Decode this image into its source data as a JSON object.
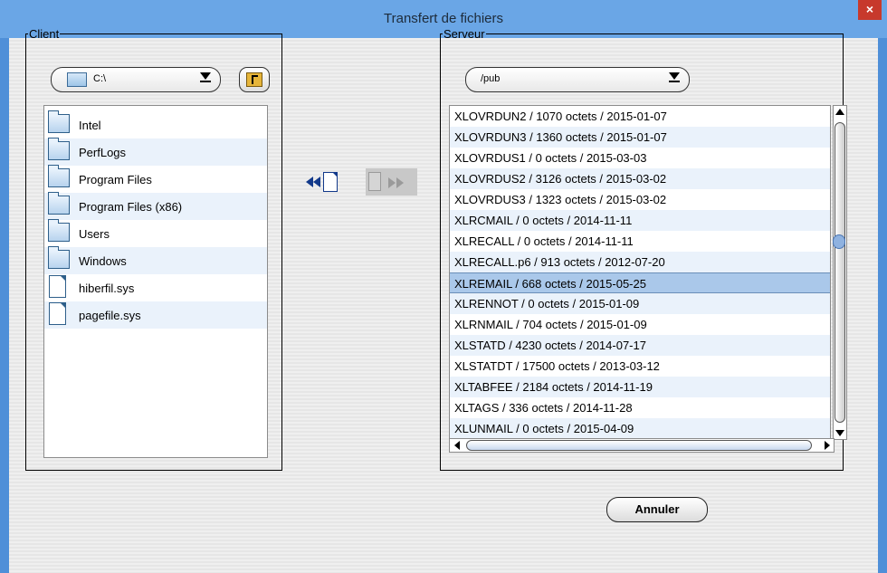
{
  "window": {
    "title": "Transfert de fichiers",
    "close_glyph": "×"
  },
  "client": {
    "legend": "Client",
    "path": "C:\\",
    "items": [
      {
        "name": "Intel",
        "icon": "folder-icon"
      },
      {
        "name": "PerfLogs",
        "icon": "folder-icon"
      },
      {
        "name": "Program Files",
        "icon": "folder-icon"
      },
      {
        "name": "Program Files (x86)",
        "icon": "folder-icon"
      },
      {
        "name": "Users",
        "icon": "folder-icon"
      },
      {
        "name": "Windows",
        "icon": "folder-icon"
      },
      {
        "name": "hiberfil.sys",
        "icon": "file-icon"
      },
      {
        "name": "pagefile.sys",
        "icon": "file-icon"
      }
    ]
  },
  "server": {
    "legend": "Serveur",
    "path": "/pub",
    "selected_index": 8,
    "items": [
      "XLOVRDUN2 / 1070 octets / 2015-01-07",
      "XLOVRDUN3 / 1360 octets / 2015-01-07",
      "XLOVRDUS1 / 0 octets / 2015-03-03",
      "XLOVRDUS2 / 3126 octets / 2015-03-02",
      "XLOVRDUS3 / 1323 octets / 2015-03-02",
      "XLRCMAIL / 0 octets / 2014-11-11",
      "XLRECALL / 0 octets / 2014-11-11",
      "XLRECALL.p6 / 913 octets / 2012-07-20",
      "XLREMAIL / 668 octets / 2015-05-25",
      "XLRENNOT / 0 octets / 2015-01-09",
      "XLRNMAIL / 704 octets / 2015-01-09",
      "XLSTATD / 4230 octets / 2014-07-17",
      "XLSTATDT / 17500 octets / 2013-03-12",
      "XLTABFEE / 2184 octets / 2014-11-19",
      "XLTAGS / 336 octets / 2014-11-28",
      "XLUNMAIL / 0 octets / 2015-04-09"
    ]
  },
  "actions": {
    "cancel_label": "Annuler"
  }
}
